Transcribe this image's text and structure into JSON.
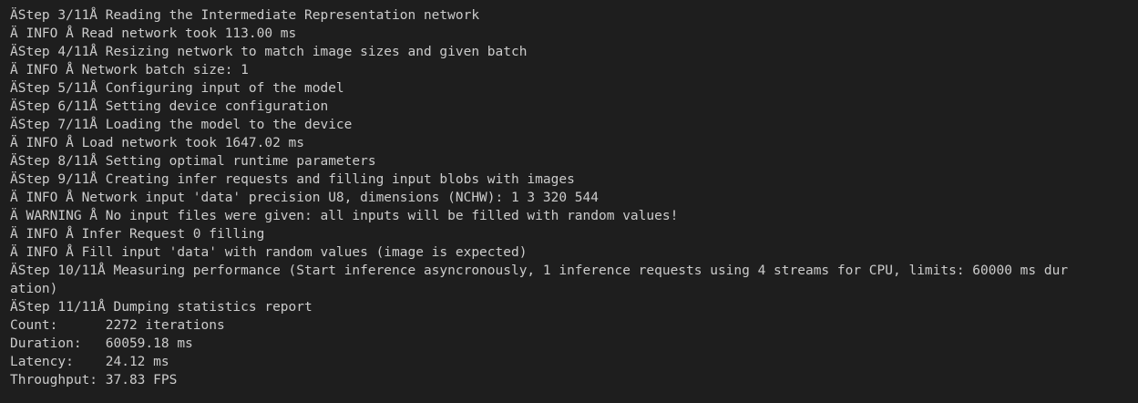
{
  "terminal": {
    "lines": [
      "ÄStep 3/11Å Reading the Intermediate Representation network",
      "Ä INFO Å Read network took 113.00 ms",
      "ÄStep 4/11Å Resizing network to match image sizes and given batch",
      "Ä INFO Å Network batch size: 1",
      "ÄStep 5/11Å Configuring input of the model",
      "ÄStep 6/11Å Setting device configuration",
      "ÄStep 7/11Å Loading the model to the device",
      "Ä INFO Å Load network took 1647.02 ms",
      "ÄStep 8/11Å Setting optimal runtime parameters",
      "ÄStep 9/11Å Creating infer requests and filling input blobs with images",
      "Ä INFO Å Network input 'data' precision U8, dimensions (NCHW): 1 3 320 544",
      "Ä WARNING Å No input files were given: all inputs will be filled with random values!",
      "Ä INFO Å Infer Request 0 filling",
      "Ä INFO Å Fill input 'data' with random values (image is expected)",
      "ÄStep 10/11Å Measuring performance (Start inference asyncronously, 1 inference requests using 4 streams for CPU, limits: 60000 ms dur",
      "ation)",
      "ÄStep 11/11Å Dumping statistics report",
      "Count:      2272 iterations",
      "Duration:   60059.18 ms",
      "Latency:    24.12 ms",
      "Throughput: 37.83 FPS"
    ]
  }
}
